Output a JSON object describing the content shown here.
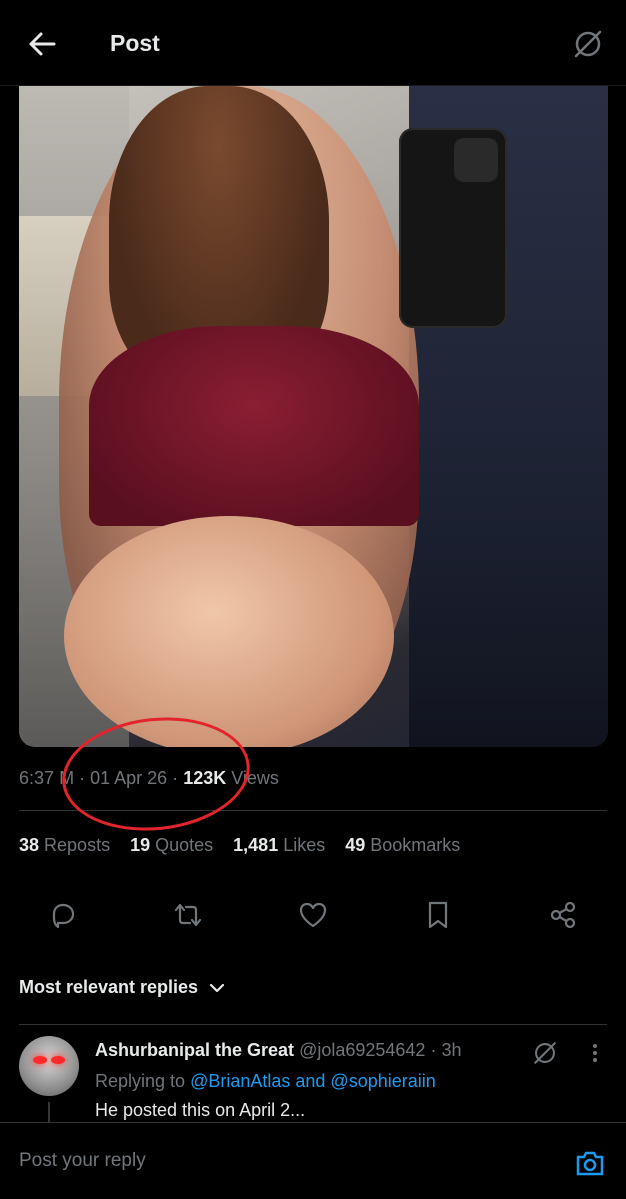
{
  "header": {
    "title": "Post",
    "back_icon": "arrow-left-icon",
    "grok_icon": "grok-icon"
  },
  "post": {
    "media_description_icon": "photo",
    "meta": {
      "time": "6:37",
      "time_suffix": "M",
      "date": "01 Apr 26",
      "views_count": "123K",
      "views_label": "Views"
    },
    "stats": {
      "reposts_count": "38",
      "reposts_label": "Reposts",
      "quotes_count": "19",
      "quotes_label": "Quotes",
      "likes_count": "1,481",
      "likes_label": "Likes",
      "bookmarks_count": "49",
      "bookmarks_label": "Bookmarks"
    },
    "actions": [
      "reply-icon",
      "repost-icon",
      "like-icon",
      "bookmark-icon",
      "share-icon"
    ],
    "annotation_color": "#e4242d"
  },
  "replies": {
    "sort_label": "Most relevant replies",
    "items": [
      {
        "name": "Ashurbanipal the Great",
        "handle": "@jola69254642",
        "time": "3h",
        "replying_prefix": "Replying to",
        "replying_to": "@BrianAtlas and @sophieraiin",
        "text": "He posted this on April 2..."
      }
    ]
  },
  "composer": {
    "placeholder": "Post your reply",
    "camera_icon": "camera-icon"
  },
  "colors": {
    "background": "#000000",
    "text": "#e7e9ea",
    "muted": "#71767b",
    "link": "#1d9bf0"
  }
}
